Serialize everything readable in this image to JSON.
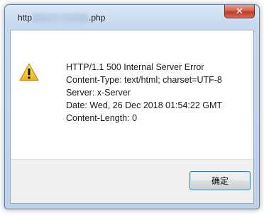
{
  "window": {
    "title_prefix": "http",
    "title_suffix": ".php",
    "close_label": "✕"
  },
  "message": {
    "lines": [
      "HTTP/1.1 500 Internal Server Error",
      "Content-Type: text/html; charset=UTF-8",
      "Server: x-Server",
      "Date: Wed, 26 Dec 2018 01:54:22 GMT",
      "Content-Length: 0"
    ]
  },
  "icon": {
    "name": "warning-icon",
    "color": "#f2c230"
  },
  "buttons": {
    "ok_label": "确定"
  }
}
